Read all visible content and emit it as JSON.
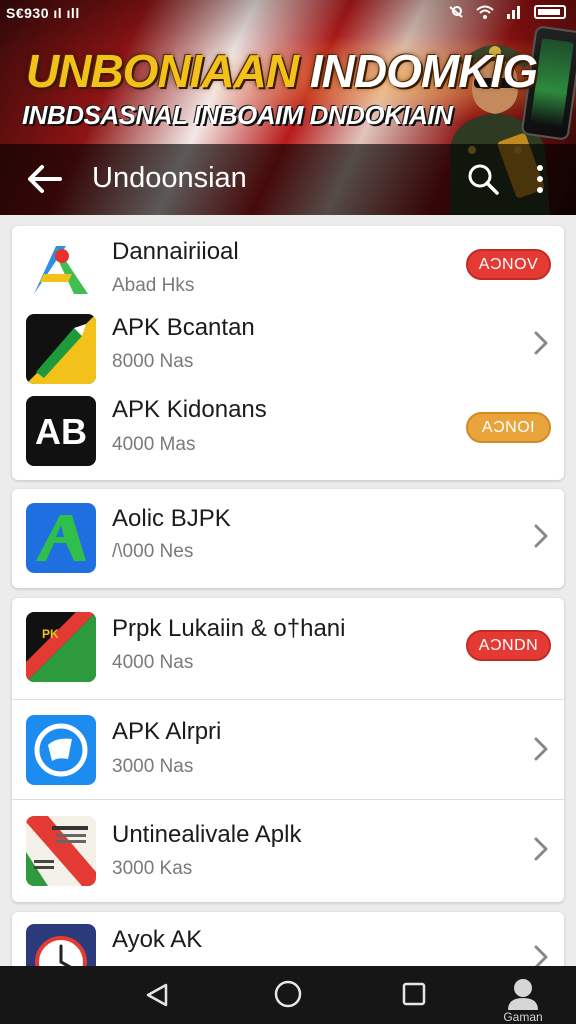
{
  "status_bar": {
    "carrier": "S€930 ıl ıll",
    "wifi_icon": "wifi-icon",
    "signal_icon": "signal-icon"
  },
  "banner": {
    "headline_part1": "UNBONIAAN",
    "headline_part2": "INDOMKIG",
    "subheadline": "INBDSASNAL INBOAIM DNDOKIAIN"
  },
  "app_bar": {
    "title": "Undoonsian"
  },
  "colors": {
    "accent_red": "#e33b33",
    "accent_orange": "#e9a53c",
    "navbar": "#161616"
  },
  "cards": [
    {
      "items": [
        {
          "name": "Dannairiioal",
          "meta": "Abad Hks",
          "action": "AƆNOV",
          "action_style": "red",
          "icon": "colorful-a-icon"
        },
        {
          "name": "APK Bcantan",
          "meta": "8000 Nas",
          "action": null,
          "icon": "green-yellow-arrow-icon"
        },
        {
          "name": "APK Kidonans",
          "meta": "4000 Mas",
          "action": "AƆNOI",
          "action_style": "orange",
          "icon": "ab-logo-icon"
        }
      ]
    },
    {
      "items": [
        {
          "name": "Aolic BJPK",
          "meta": "/\\000 Nes",
          "action": null,
          "icon": "blue-green-a-icon"
        }
      ]
    },
    {
      "items": [
        {
          "name": "Prpk Lukaiin & o†hani",
          "meta": "4000 Nas",
          "action": "AƆNDN",
          "action_style": "red",
          "icon": "red-green-flag-icon"
        },
        {
          "name": "APK Alrpri",
          "meta": "3000 Nas",
          "action": null,
          "icon": "blue-circle-book-icon"
        },
        {
          "name": "Untinealivale Aplk",
          "meta": "3000 Kas",
          "action": null,
          "icon": "news-flag-icon"
        }
      ]
    },
    {
      "items": [
        {
          "name": "Ayok AK",
          "meta": "",
          "action": null,
          "icon": "clock-icon"
        }
      ]
    }
  ],
  "navbar": {
    "profile_label": "Gaman"
  }
}
